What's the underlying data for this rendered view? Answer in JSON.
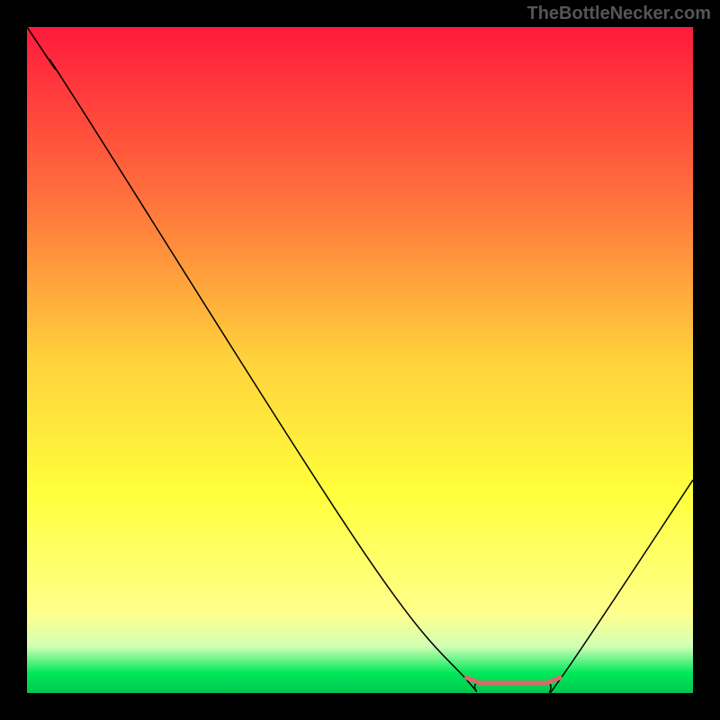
{
  "watermark": "TheBottleNecker.com",
  "chart_data": {
    "type": "line",
    "title": "",
    "xlabel": "",
    "ylabel": "",
    "xlim": [
      0,
      100
    ],
    "ylim": [
      0,
      100
    ],
    "background_gradient": {
      "stops": [
        {
          "offset": 0,
          "color": "#ff1a3c"
        },
        {
          "offset": 25,
          "color": "#ff6e3c"
        },
        {
          "offset": 50,
          "color": "#ffd23c"
        },
        {
          "offset": 70,
          "color": "#ffff3c"
        },
        {
          "offset": 88,
          "color": "#ffff8c"
        },
        {
          "offset": 93,
          "color": "#d2ffb4"
        },
        {
          "offset": 97,
          "color": "#00e85a"
        },
        {
          "offset": 100,
          "color": "#00c850"
        }
      ]
    },
    "series": [
      {
        "name": "bottleneck-curve",
        "color": "#000000",
        "width": 1.5,
        "points": [
          {
            "x": 0,
            "y": 100
          },
          {
            "x": 4,
            "y": 94
          },
          {
            "x": 8,
            "y": 88
          },
          {
            "x": 50,
            "y": 22
          },
          {
            "x": 66,
            "y": 2
          },
          {
            "x": 68,
            "y": 1.5
          },
          {
            "x": 78,
            "y": 1.5
          },
          {
            "x": 80,
            "y": 2
          },
          {
            "x": 100,
            "y": 32
          }
        ]
      }
    ],
    "marker": {
      "name": "optimal-range",
      "color": "#d86a6a",
      "width": 5,
      "points": [
        {
          "x": 66,
          "y": 2.3
        },
        {
          "x": 68,
          "y": 1.5
        },
        {
          "x": 78,
          "y": 1.5
        },
        {
          "x": 80,
          "y": 2.3
        }
      ]
    }
  }
}
